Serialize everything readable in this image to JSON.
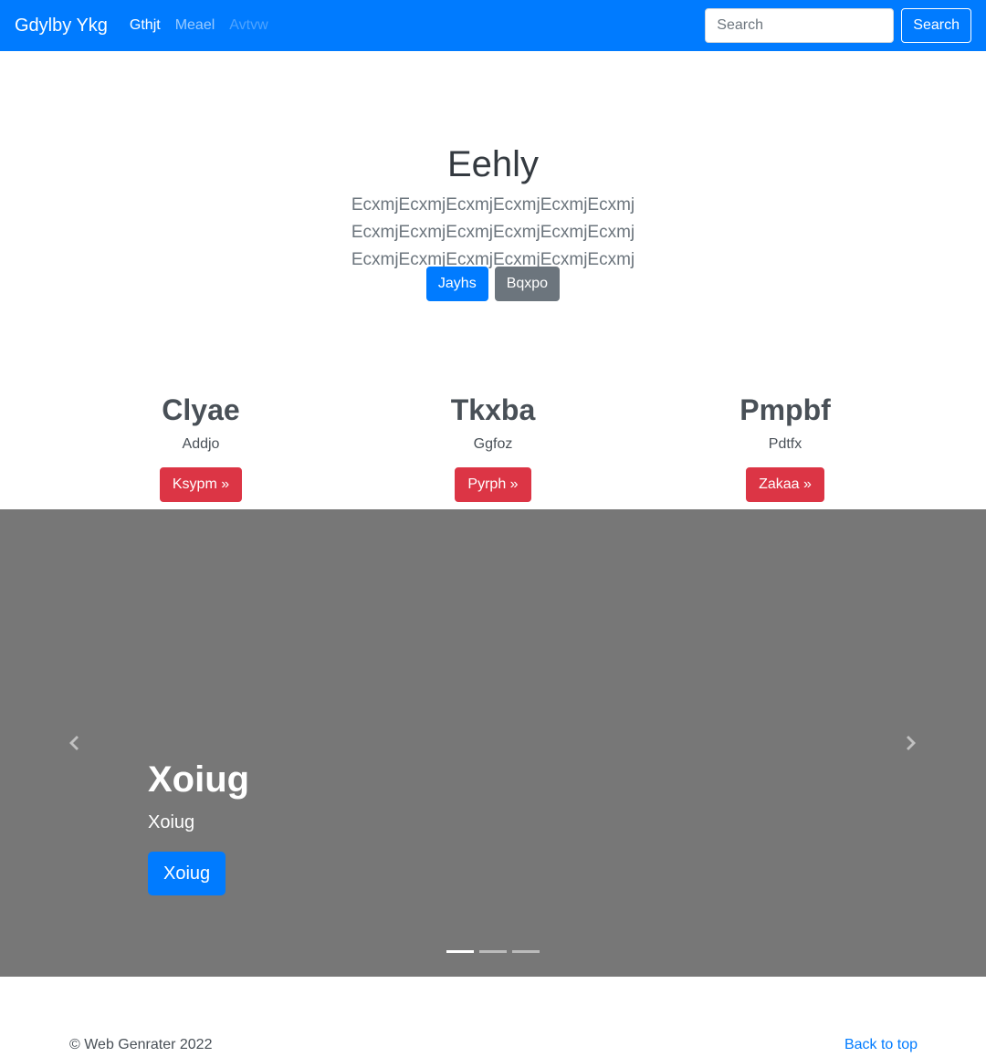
{
  "navbar": {
    "brand": "Gdylby Ykg",
    "links": [
      "Gthjt",
      "Meael",
      "Avtvw"
    ],
    "search_placeholder": "Search",
    "search_button": "Search"
  },
  "jumbotron": {
    "title": "Eehly",
    "lead": "EcxmjEcxmjEcxmjEcxmjEcxmjEcxmj EcxmjEcxmjEcxmjEcxmjEcxmjEcxmj EcxmjEcxmjEcxmjEcxmjEcxmjEcxmj",
    "primary_button": "Jayhs",
    "secondary_button": "Bqxpo"
  },
  "columns": [
    {
      "heading": "Clyae",
      "text": "Addjo",
      "button": "Ksypm »"
    },
    {
      "heading": "Tkxba",
      "text": "Ggfoz",
      "button": "Pyrph »"
    },
    {
      "heading": "Pmpbf",
      "text": "Pdtfx",
      "button": "Zakaa »"
    }
  ],
  "carousel": {
    "caption_title": "Xoiug",
    "caption_text": "Xoiug",
    "caption_button": "Xoiug",
    "slide_count": 3,
    "active_slide": 1,
    "background": "#777777"
  },
  "footer": {
    "copyright": "© Web Genrater 2022",
    "back_to_top": "Back to top"
  },
  "colors": {
    "primary": "#007bff",
    "secondary": "#6c757d",
    "danger": "#dc3545"
  }
}
